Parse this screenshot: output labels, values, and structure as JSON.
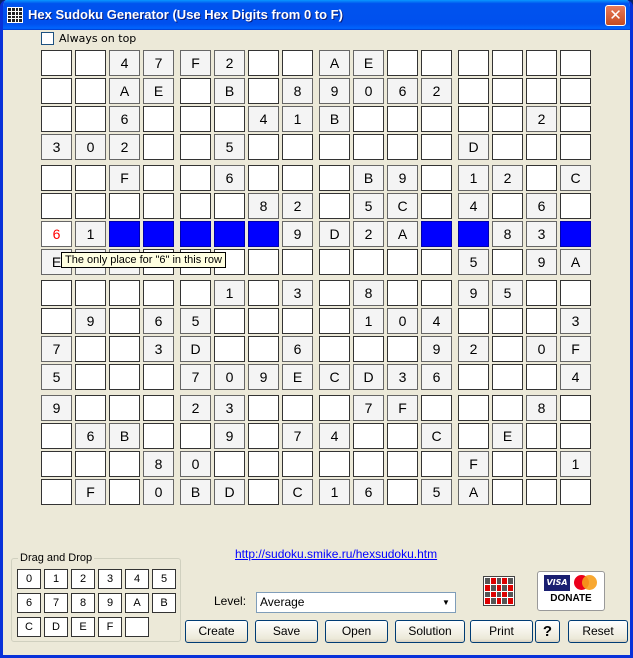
{
  "window": {
    "title": "Hex Sudoku Generator (Use Hex Digits from 0 to F)",
    "close_label": "✕"
  },
  "always_on_top_label": "Always on top",
  "grid": {
    "rows": [
      [
        "",
        "",
        "4",
        "7",
        "F",
        "2",
        "",
        "",
        "A",
        "E",
        "",
        "",
        "",
        "",
        "",
        ""
      ],
      [
        "",
        "",
        "A",
        "E",
        "",
        "B",
        "",
        "8",
        "9",
        "0",
        "6",
        "2",
        "",
        "",
        "",
        ""
      ],
      [
        "",
        "",
        "6",
        "",
        "",
        "",
        "4",
        "1",
        "B",
        "",
        "",
        "",
        "",
        "",
        "2",
        ""
      ],
      [
        "3",
        "0",
        "2",
        "",
        "",
        "5",
        "",
        "",
        "",
        "",
        "",
        "",
        "D",
        "",
        "",
        ""
      ],
      [
        "",
        "",
        "F",
        "",
        "",
        "6",
        "",
        "",
        "",
        "B",
        "9",
        "",
        "1",
        "2",
        "",
        "C"
      ],
      [
        "",
        "",
        "",
        "",
        "",
        "",
        "8",
        "2",
        "",
        "5",
        "C",
        "",
        "4",
        "",
        "6",
        ""
      ],
      [
        "6",
        "1",
        "",
        "",
        "",
        "",
        "",
        "9",
        "D",
        "2",
        "A",
        "",
        "",
        "8",
        "3",
        ""
      ],
      [
        "E",
        "3",
        "7",
        "",
        "",
        "",
        "",
        "",
        "",
        "",
        "",
        "",
        "5",
        "",
        "9",
        "A"
      ],
      [
        "",
        "",
        "",
        "",
        "",
        "1",
        "",
        "3",
        "",
        "8",
        "",
        "",
        "9",
        "5",
        "",
        ""
      ],
      [
        "",
        "9",
        "",
        "6",
        "5",
        "",
        "",
        "",
        "",
        "1",
        "0",
        "4",
        "",
        "",
        "",
        "3"
      ],
      [
        "7",
        "",
        "",
        "3",
        "D",
        "",
        "",
        "6",
        "",
        "",
        "",
        "9",
        "2",
        "",
        "0",
        "F"
      ],
      [
        "5",
        "",
        "",
        "",
        "7",
        "0",
        "9",
        "E",
        "C",
        "D",
        "3",
        "6",
        "",
        "",
        "",
        "4"
      ],
      [
        "9",
        "",
        "",
        "",
        "2",
        "3",
        "",
        "",
        "",
        "7",
        "F",
        "",
        "",
        "",
        "8",
        ""
      ],
      [
        "",
        "6",
        "B",
        "",
        "",
        "9",
        "",
        "7",
        "4",
        "",
        "",
        "C",
        "",
        "E",
        "",
        ""
      ],
      [
        "",
        "",
        "",
        "8",
        "0",
        "",
        "",
        "",
        "",
        "",
        "",
        "",
        "F",
        "",
        "",
        "1"
      ],
      [
        "",
        "F",
        "",
        "0",
        "B",
        "D",
        "",
        "C",
        "1",
        "6",
        "",
        "5",
        "A",
        "",
        "",
        ""
      ]
    ],
    "highlight_row": 6,
    "highlight_cols": [
      2,
      3,
      4,
      5,
      6,
      11,
      12,
      15
    ],
    "hint_cell": [
      6,
      0
    ],
    "highlight_color": "#0000ff",
    "hint_color": "#ff0000"
  },
  "tooltip": "The only place for \"6\" in this row",
  "link": "http://sudoku.smike.ru/hexsudoku.htm",
  "drag_drop": {
    "label": "Drag and Drop",
    "tiles": [
      "0",
      "1",
      "2",
      "3",
      "4",
      "5",
      "6",
      "7",
      "8",
      "9",
      "A",
      "B",
      "C",
      "D",
      "E",
      "F",
      ""
    ]
  },
  "level": {
    "label": "Level:",
    "value": "Average"
  },
  "buttons": {
    "create": "Create",
    "save": "Save",
    "open": "Open",
    "solution": "Solution",
    "print": "Print",
    "help": "?",
    "reset": "Reset"
  },
  "donate": {
    "visa": "VISA",
    "label": "DONATE"
  }
}
